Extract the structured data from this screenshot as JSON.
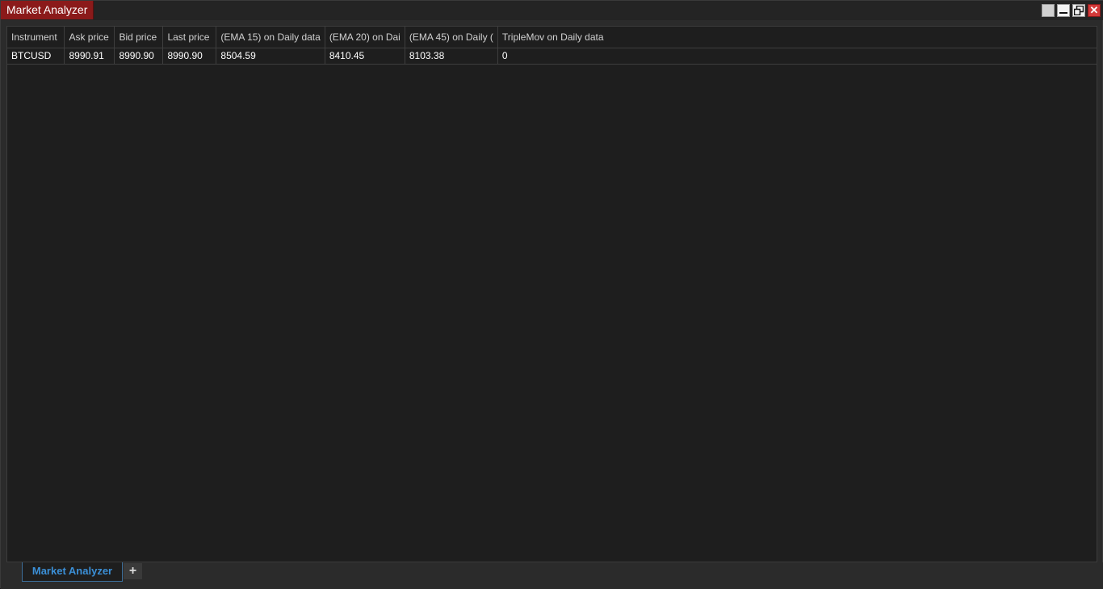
{
  "window": {
    "title": "Market Analyzer",
    "buttons": {
      "close": "✕",
      "restore": "⧉"
    }
  },
  "table": {
    "columns": [
      "Instrument",
      "Ask price",
      "Bid price",
      "Last price",
      "(EMA 15) on Daily data",
      "(EMA 20) on Dai",
      "(EMA 45) on Daily (",
      "TripleMov on Daily data"
    ],
    "rows": [
      [
        "BTCUSD",
        "8990.91",
        "8990.90",
        "8990.90",
        "8504.59",
        "8410.45",
        "8103.38",
        "0"
      ]
    ]
  },
  "tabs": {
    "active_label": "Market Analyzer",
    "add_label": "+"
  }
}
